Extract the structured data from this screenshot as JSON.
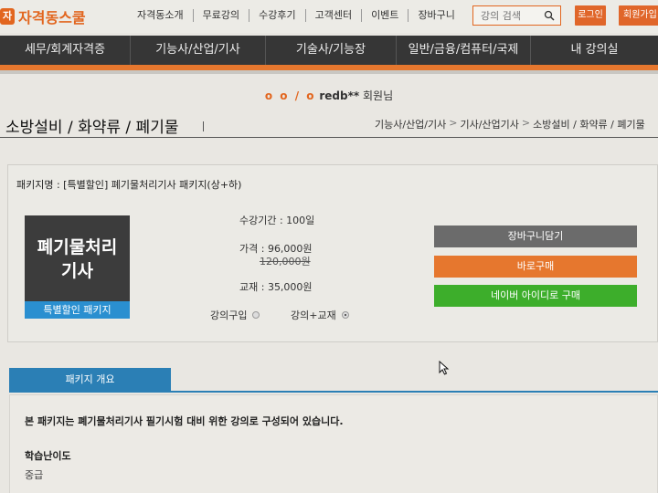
{
  "logo": {
    "text": "자격동스쿨"
  },
  "top_nav": [
    "자격동소개",
    "무료강의",
    "수강후기",
    "고객센터",
    "이벤트",
    "장바구니"
  ],
  "search": {
    "placeholder": "강의 검색"
  },
  "auth": {
    "login": "로그인",
    "join": "회원가입"
  },
  "main_nav": [
    "세무/회계자격증",
    "기능사/산업/기사",
    "기술사/기능장",
    "일반/금융/컴퓨터/국제",
    "내 강의실"
  ],
  "member": {
    "prefix": "o o / o",
    "user": "redb**",
    "suffix": "회원님"
  },
  "page_title": "소방설비 / 화약류 / 폐기물",
  "breadcrumb": [
    "기능사/산업/기사",
    "기사/산업기사",
    "소방설비 / 화약류 / 폐기물"
  ],
  "package": {
    "name": "패키지명 : [특별할인] 폐기물처리기사 패키지(상+하)",
    "thumb_line1": "폐기물처리",
    "thumb_line2": "기사",
    "thumb_badge": "특별할인 패키지",
    "period": "수강기간 : 100일",
    "price": "가격 : 96,000원",
    "original_price": "120,000원",
    "book": "교재 : 35,000원",
    "option_lecture": "강의구입",
    "option_lecture_book": "강의+교재",
    "selected_option": "강의+교재",
    "cart_button": "장바구니담기",
    "buy_button": "바로구매",
    "naver_button": "네이버 아이디로 구매"
  },
  "overview": {
    "tab": "패키지 개요",
    "description": "본 패키지는 폐기물처리기사 필기시험 대비 위한 강의로 구성되어 있습니다.",
    "difficulty_label": "학습난이도",
    "difficulty_value": "중급"
  },
  "colors": {
    "accent": "#e6772e",
    "nav_bg": "#363636",
    "cart": "#6b6b6b",
    "naver": "#3dae2b",
    "tab": "#2b7fb5"
  }
}
